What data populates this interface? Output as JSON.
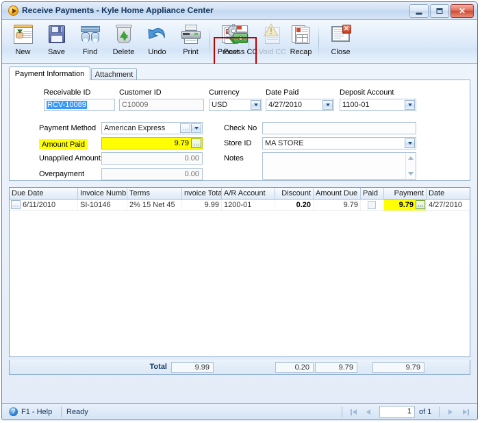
{
  "window": {
    "title": "Receive Payments - Kyle Home Appliance Center",
    "icon": "play-circle-icon",
    "controls": {
      "minimize": "minimize-icon",
      "maximize": "maximize-icon",
      "close": "close-icon"
    }
  },
  "toolbar": {
    "buttons": [
      {
        "label": "New",
        "icon": "new-document-icon",
        "disabled": false,
        "highlighted": false
      },
      {
        "label": "Save",
        "icon": "floppy-disk-icon",
        "disabled": false,
        "highlighted": false
      },
      {
        "label": "Find",
        "icon": "binoculars-icon",
        "disabled": false,
        "highlighted": false
      },
      {
        "label": "Delete",
        "icon": "recycle-bin-icon",
        "disabled": false,
        "highlighted": false
      },
      {
        "label": "Undo",
        "icon": "undo-arrow-icon",
        "disabled": false,
        "highlighted": false
      },
      {
        "label": "Print",
        "icon": "printer-icon",
        "disabled": false,
        "highlighted": false
      },
      {
        "label": "Post",
        "icon": "post-check-icon",
        "disabled": false,
        "highlighted": false
      },
      {
        "label": "Process CC",
        "icon": "gear-card-icon",
        "disabled": false,
        "highlighted": true
      },
      {
        "label": "Void CC",
        "icon": "warning-void-icon",
        "disabled": true,
        "highlighted": false
      },
      {
        "label": "Recap",
        "icon": "recap-report-icon",
        "disabled": false,
        "highlighted": false
      },
      {
        "label": "Close",
        "icon": "close-window-icon",
        "disabled": false,
        "highlighted": false
      }
    ]
  },
  "tabs": [
    {
      "label": "Payment Information",
      "active": true
    },
    {
      "label": "Attachment",
      "active": false
    }
  ],
  "form": {
    "receivable_id": {
      "label": "Receivable ID",
      "value": "RCV-10089"
    },
    "customer_id": {
      "label": "Customer ID",
      "value": "C10009"
    },
    "currency": {
      "label": "Currency",
      "value": "USD"
    },
    "date_paid": {
      "label": "Date Paid",
      "value": "4/27/2010"
    },
    "deposit_account": {
      "label": "Deposit Account",
      "value": "1100-01"
    },
    "payment_method": {
      "label": "Payment Method",
      "value": "American Express"
    },
    "amount_paid": {
      "label": "Amount Paid",
      "value": "9.79"
    },
    "unapplied": {
      "label": "Unapplied Amount",
      "value": "0.00"
    },
    "overpayment": {
      "label": "Overpayment",
      "value": "0.00"
    },
    "check_no": {
      "label": "Check No",
      "value": ""
    },
    "store_id": {
      "label": "Store ID",
      "value": "MA STORE"
    },
    "notes": {
      "label": "Notes",
      "value": ""
    }
  },
  "grid": {
    "columns": [
      "Due Date",
      "Invoice Numb",
      "Terms",
      "nvoice Total",
      "A/R Account",
      "Discount",
      "Amount Due",
      "Paid",
      "Payment",
      "Date"
    ],
    "rows": [
      {
        "due_date": "6/11/2010",
        "invoice_number": "SI-10146",
        "terms": "2% 15 Net 45",
        "invoice_total": "9.99",
        "ar_account": "1200-01",
        "discount": "0.20",
        "amount_due": "9.79",
        "paid": false,
        "payment": "9.79",
        "date": "4/27/2010"
      }
    ]
  },
  "totals": {
    "label": "Total",
    "invoice_total": "9.99",
    "discount": "0.20",
    "amount_due": "9.79",
    "payment": "9.79"
  },
  "status": {
    "help": "F1 - Help",
    "state": "Ready",
    "page": "1",
    "of": "of 1"
  },
  "colors": {
    "highlight_yellow": "#ffff00",
    "callout_red": "#c00000",
    "selection_blue": "#3399ff",
    "frame_blue": "#7ea2c8"
  }
}
